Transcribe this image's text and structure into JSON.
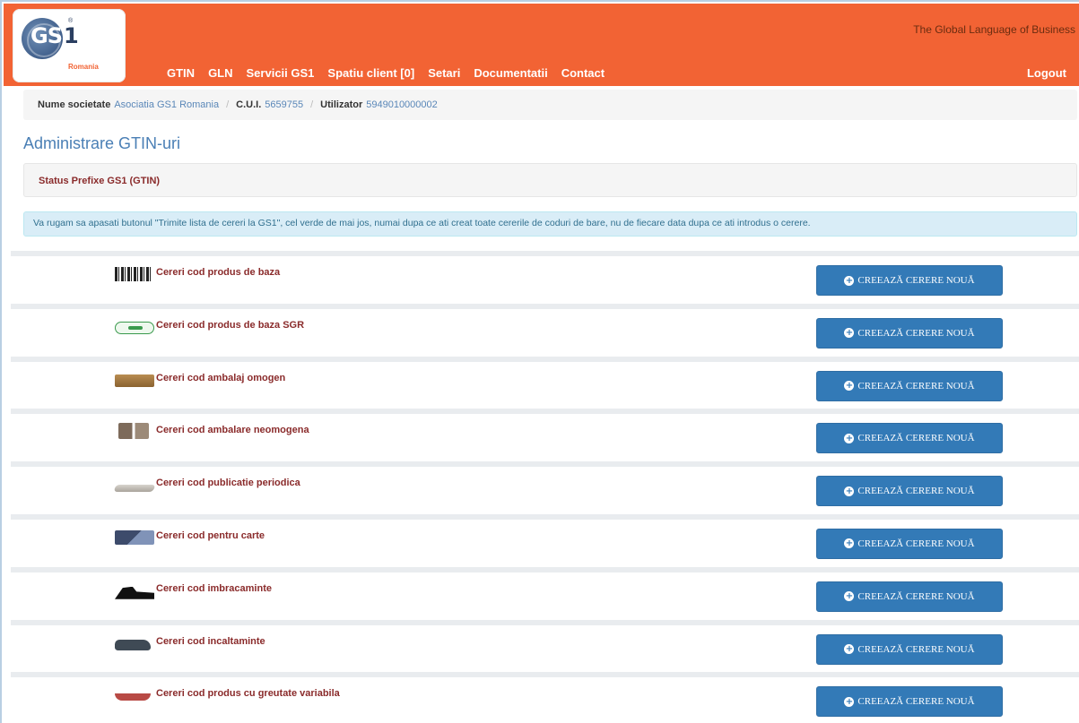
{
  "header": {
    "logo": {
      "brand": "GS",
      "brand_one": "1",
      "sub": "Romania",
      "reg": "®"
    },
    "tagline": "The Global Language of Business",
    "nav": [
      "GTIN",
      "GLN",
      "Servicii GS1",
      "Spatiu client [0]",
      "Setari",
      "Documentatii",
      "Contact"
    ],
    "logout": "Logout"
  },
  "infobar": {
    "company_label": "Nume societate",
    "company_value": "Asociatia GS1 Romania",
    "cui_label": "C.U.I.",
    "cui_value": "5659755",
    "user_label": "Utilizator",
    "user_value": "5949010000002"
  },
  "page_title": "Administrare GTIN-uri",
  "status_title": "Status Prefixe GS1 (GTIN)",
  "notice": "Va rugam sa apasati butonul \"Trimite lista de cereri la GS1\", cel verde de mai jos, numai dupa ce ati creat toate cererile de coduri de bare, nu de fiecare data dupa ce ati introdus o cerere.",
  "rows": [
    {
      "label": "Cereri cod produs de baza",
      "icon": "barcode-icon",
      "button": "CREEAZĂ CERERE NOUĂ"
    },
    {
      "label": "Cereri cod produs de baza SGR",
      "icon": "sgr-icon",
      "button": "CREEAZĂ CERERE NOUĂ"
    },
    {
      "label": "Cereri cod ambalaj omogen",
      "icon": "box-icon",
      "button": "CREEAZĂ CERERE NOUĂ"
    },
    {
      "label": "Cereri cod ambalare neomogena",
      "icon": "mixed-package-icon",
      "button": "CREEAZĂ CERERE NOUĂ"
    },
    {
      "label": "Cereri cod publicatie periodica",
      "icon": "newspaper-icon",
      "button": "CREEAZĂ CERERE NOUĂ"
    },
    {
      "label": "Cereri cod pentru carte",
      "icon": "book-icon",
      "button": "CREEAZĂ CERERE NOUĂ"
    },
    {
      "label": "Cereri cod imbracaminte",
      "icon": "clothing-icon",
      "button": "CREEAZĂ CERERE NOUĂ"
    },
    {
      "label": "Cereri cod incaltaminte",
      "icon": "shoe-icon",
      "button": "CREEAZĂ CERERE NOUĂ"
    },
    {
      "label": "Cereri cod produs cu greutate variabila",
      "icon": "variable-weight-icon",
      "button": "CREEAZĂ CERERE NOUĂ"
    }
  ],
  "colors": {
    "header": "#f26334",
    "button": "#337ab7",
    "label": "#8a2b2b",
    "title": "#4a7fb5"
  }
}
